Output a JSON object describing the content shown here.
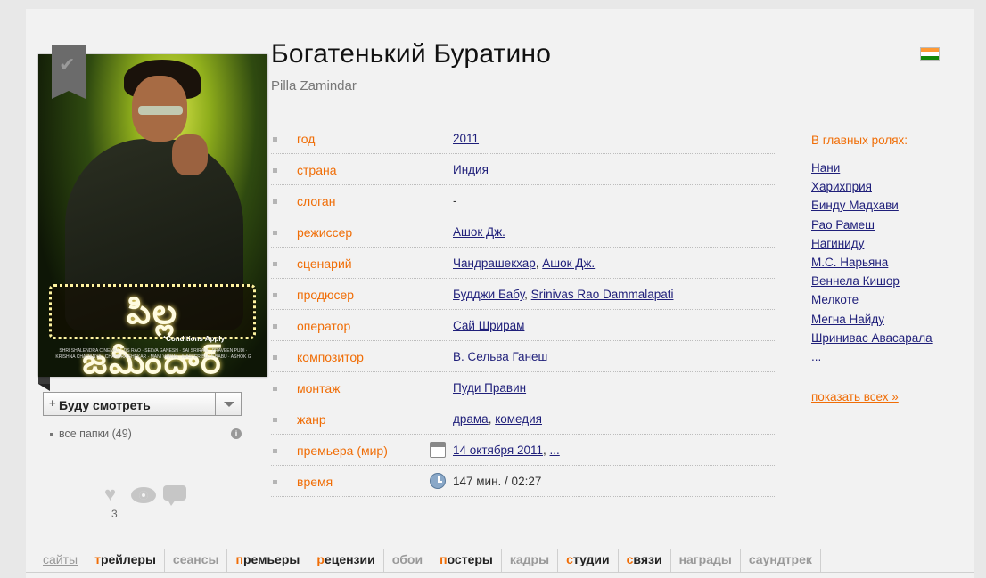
{
  "movie": {
    "title": "Богатенький Буратино",
    "original_title": "Pilla Zamindar",
    "poster_logo": "పిల్ల జమీందార్",
    "poster_conditions": "*Conditions Apply",
    "poster_credits": "SHRI SHALENDRA CINEMAS · DS RAO · SELVA GANESH · SAI SRIRAM · PRAVEEN PUDI · KRISHNA CHAITANYA · CHANDRA SHEKAR · MANI VARMA · MASTER BUJJI BABU · ASHOK G"
  },
  "flag": {
    "name": "india-flag",
    "colors": [
      "#ff9933",
      "#ffffff",
      "#138808"
    ]
  },
  "info_rows": [
    {
      "label": "год",
      "values": [
        "2011"
      ]
    },
    {
      "label": "страна",
      "values": [
        "Индия"
      ]
    },
    {
      "label": "слоган",
      "text": "-"
    },
    {
      "label": "режиссер",
      "values": [
        "Ашок Дж."
      ]
    },
    {
      "label": "сценарий",
      "values": [
        "Чандрашекхар",
        "Ашок Дж."
      ]
    },
    {
      "label": "продюсер",
      "values": [
        "Будджи Бабу",
        "Srinivas Rao Dammalapati"
      ]
    },
    {
      "label": "оператор",
      "values": [
        "Сай Шрирам"
      ]
    },
    {
      "label": "композитор",
      "values": [
        "В. Сельва Ганеш"
      ]
    },
    {
      "label": "монтаж",
      "values": [
        "Пуди Правин"
      ]
    },
    {
      "label": "жанр",
      "values": [
        "драма",
        "комедия"
      ]
    },
    {
      "label": "премьера (мир)",
      "icon": "calendar-icon",
      "values": [
        "14 октября 2011",
        "..."
      ]
    },
    {
      "label": "время",
      "icon": "clock-icon",
      "text": "147 мин. / 02:27"
    }
  ],
  "cast": {
    "heading": "В главных ролях:",
    "actors": [
      "Нани",
      "Харихприя",
      "Бинду Мадхави",
      "Рао Рамеш",
      "Нагиниду",
      "М.С. Нарьяна",
      "Веннела Кишор",
      "Мелкоте",
      "Мегна Найду",
      "Шринивас Авасарала",
      "..."
    ],
    "show_all": "показать всех",
    "show_all_arrow": "»"
  },
  "watch": {
    "plus": "+",
    "label": "Буду смотреть"
  },
  "folders": {
    "label": "все папки (49)",
    "info": "i"
  },
  "social": {
    "likes": "3"
  },
  "tabs": [
    {
      "first": "",
      "rest": "сайты",
      "active": false
    },
    {
      "first": "т",
      "rest": "рейлеры",
      "active": true
    },
    {
      "first": "",
      "rest": "сеансы",
      "active": false
    },
    {
      "first": "п",
      "rest": "ремьеры",
      "active": true
    },
    {
      "first": "р",
      "rest": "ецензии",
      "active": true
    },
    {
      "first": "",
      "rest": "обои",
      "active": false
    },
    {
      "first": "п",
      "rest": "остеры",
      "active": true
    },
    {
      "first": "",
      "rest": "кадры",
      "active": false
    },
    {
      "first": "с",
      "rest": "тудии",
      "active": true
    },
    {
      "first": "с",
      "rest": "вязи",
      "active": true
    },
    {
      "first": "",
      "rest": "награды",
      "active": false
    },
    {
      "first": "",
      "rest": "саундтрек",
      "active": false
    }
  ]
}
